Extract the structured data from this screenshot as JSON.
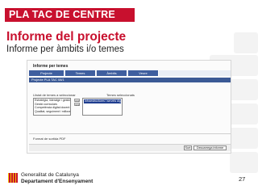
{
  "header": {
    "label": "PLA TAC DE CENTRE"
  },
  "title": "Informe del projecte",
  "subtitle": "Informe per àmbits i/o temes",
  "screenshot": {
    "title": "Informe per temes",
    "tabs": [
      "Projecte",
      "Temes",
      "Àmbits",
      "Veure"
    ],
    "band_label": "Projecte PLA TAC 08/1",
    "available_label": "Llistat de temes a seleccionar",
    "selected_label": "Temes seleccionats",
    "available_items": [
      "Estratègia, lideratge i gestió",
      "Gestió curriculars",
      "Competència digital docent i d",
      "Qualitat, seguiment i millora"
    ],
    "selected_items": [
      "Infraestructures i serveis dig"
    ],
    "arrow_buttons": [
      ">>",
      "<<"
    ],
    "format_label": "Format de sortida PDF",
    "buttons": {
      "sort": "Surt",
      "download": "Descarrega informe"
    }
  },
  "footer": {
    "org_line1": "Generalitat de Catalunya",
    "org_line2": "Departament d'Ensenyament",
    "page_number": "27"
  },
  "colors": {
    "brand_red": "#c8102e",
    "tab_blue": "#3f5f9f",
    "selection_blue": "#1e3d8f"
  }
}
